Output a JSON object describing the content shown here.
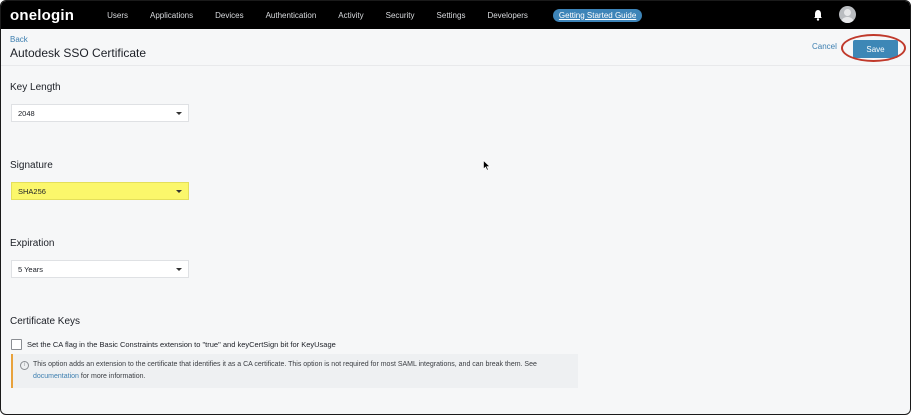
{
  "nav": {
    "logo": "onelogin",
    "items": [
      "Users",
      "Applications",
      "Devices",
      "Authentication",
      "Activity",
      "Security",
      "Settings",
      "Developers"
    ],
    "guide": "Getting Started Guide",
    "icons": [
      "bell-icon",
      "user-avatar-icon"
    ]
  },
  "header": {
    "back": "Back",
    "title": "Autodesk SSO Certificate",
    "cancel": "Cancel",
    "save": "Save"
  },
  "sections": {
    "key_length": {
      "title": "Key Length",
      "value": "2048"
    },
    "signature": {
      "title": "Signature",
      "value": "SHA256"
    },
    "expiration": {
      "title": "Expiration",
      "value": "5 Years"
    },
    "certificate_keys": {
      "title": "Certificate Keys",
      "checkbox_label": "Set the CA flag in the Basic Constraints extension to \"true\" and keyCertSign bit for KeyUsage",
      "info_text": "This option adds an extension to the certificate that identifies it as a CA certificate. This option is not required for most SAML integrations, and can break them. See",
      "info_link": "documentation",
      "info_suffix": "for more information."
    }
  },
  "colors": {
    "nav_bg": "#000000",
    "accent": "#3d87b6",
    "highlight": "#fbf76b",
    "annotation": "#c0392b"
  }
}
